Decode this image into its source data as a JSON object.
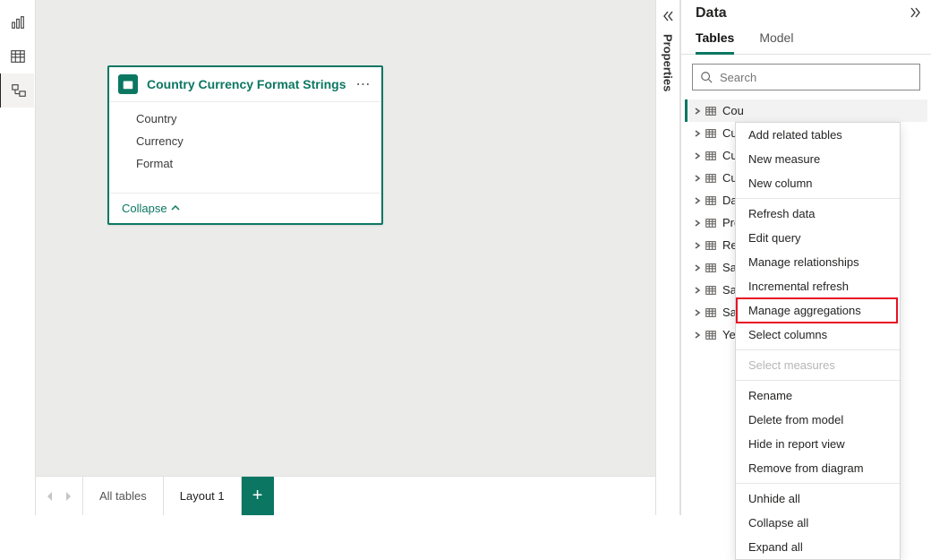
{
  "leftRail": {
    "icons": [
      "report-view",
      "data-view",
      "model-view"
    ]
  },
  "card": {
    "title": "Country Currency Format Strings",
    "fields": [
      "Country",
      "Currency",
      "Format"
    ],
    "collapse": "Collapse"
  },
  "footer": {
    "tab_all": "All tables",
    "tab_layout": "Layout 1",
    "add_label": "+"
  },
  "propsStrip": {
    "label": "Properties"
  },
  "panel": {
    "title": "Data",
    "tabs": {
      "tables": "Tables",
      "model": "Model"
    },
    "search_placeholder": "Search",
    "tables": [
      "Cou",
      "Cur",
      "Cur",
      "Cus",
      "Dat",
      "Pro",
      "Res",
      "Sal",
      "Sal",
      "Sal",
      "Yea"
    ]
  },
  "contextMenu": {
    "items": [
      "Add related tables",
      "New measure",
      "New column",
      "Refresh data",
      "Edit query",
      "Manage relationships",
      "Incremental refresh",
      "Manage aggregations",
      "Select columns",
      "Select measures",
      "Rename",
      "Delete from model",
      "Hide in report view",
      "Remove from diagram",
      "Unhide all",
      "Collapse all",
      "Expand all"
    ],
    "disabled_index": 9,
    "highlight_index": 7,
    "separators_after": [
      2,
      8,
      9,
      13
    ]
  }
}
